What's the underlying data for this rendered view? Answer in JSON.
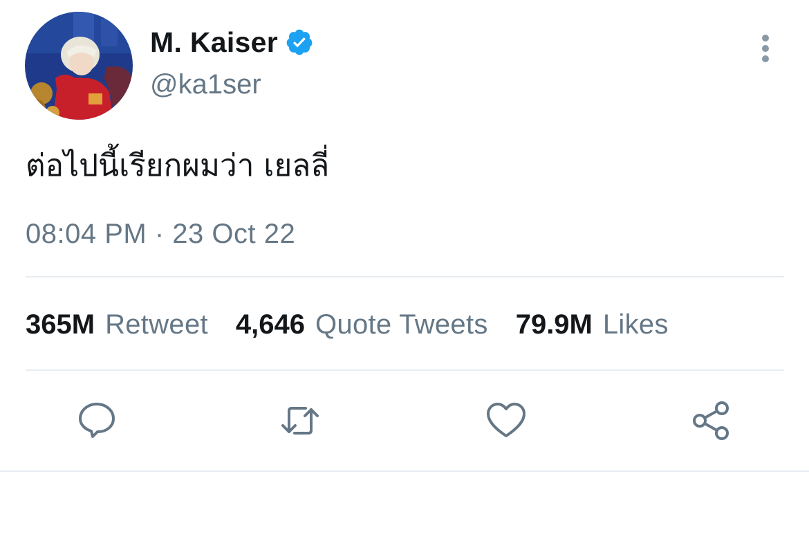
{
  "author": {
    "display_name": "M. Kaiser",
    "handle": "@ka1ser",
    "verified": true,
    "avatar_icon": "avatar-anime-character"
  },
  "tweet": {
    "text": "ต่อไปนี้เรียกผมว่า เยลลี่",
    "timestamp": "08:04 PM · 23 Oct 22"
  },
  "stats": {
    "retweets": {
      "value": "365M",
      "label": "Retweet"
    },
    "quotes": {
      "value": "4,646",
      "label": "Quote Tweets"
    },
    "likes": {
      "value": "79.9M",
      "label": "Likes"
    }
  },
  "actions": [
    {
      "name": "reply",
      "icon": "speech-bubble-icon"
    },
    {
      "name": "retweet",
      "icon": "retweet-arrows-icon"
    },
    {
      "name": "like",
      "icon": "heart-icon"
    },
    {
      "name": "share",
      "icon": "share-nodes-icon"
    }
  ],
  "colors": {
    "text_primary": "#14171a",
    "text_secondary": "#657786",
    "verified_blue": "#1da1f2",
    "divider": "#e6ecf0"
  }
}
